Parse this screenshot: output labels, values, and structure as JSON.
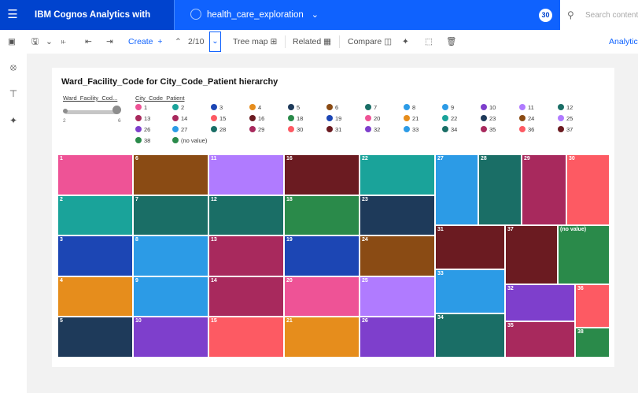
{
  "header": {
    "menu_icon": "hamburger-icon",
    "brand": "IBM Cognos Analytics with Watson",
    "report_name": "health_care_exploration",
    "avatar": "30",
    "search_placeholder": "Search content"
  },
  "toolbar": {
    "create_label": "Create",
    "page_indicator": "2/10",
    "treemap_label": "Tree map",
    "related_label": "Related",
    "compare_label": "Compare",
    "analytics_label": "Analytics"
  },
  "chart": {
    "title": "Ward_Facility_Code for City_Code_Patient hierarchy",
    "size_legend_label": "Ward_Facility_Cod...",
    "size_min": "2",
    "size_max": "6",
    "color_legend_label": "City_Code_Patient"
  },
  "colors": {
    "1": "#ee5396",
    "2": "#1aa39a",
    "3": "#1c46b4",
    "4": "#e68d1c",
    "5": "#1e3a5a",
    "6": "#8a4b14",
    "7": "#1a6e66",
    "8": "#2c9be6",
    "9": "#2c9be6",
    "10": "#7e3fcc",
    "11": "#b07bff",
    "12": "#1a6e66",
    "13": "#a8295d",
    "14": "#a8295d",
    "15": "#fd5a63",
    "16": "#6b1b21",
    "17": "#1a6e66",
    "18": "#2a8a4a",
    "19": "#1c46b4",
    "20": "#ee5396",
    "21": "#e68d1c",
    "22": "#1aa39a",
    "23": "#1e3a5a",
    "24": "#8a4b14",
    "25": "#b07bff",
    "26": "#7e3fcc",
    "27": "#2c9be6",
    "28": "#1a6e66",
    "29": "#a8295d",
    "30": "#fd5a63",
    "31": "#6b1b21",
    "32": "#7e3fcc",
    "33": "#2c9be6",
    "34": "#1a6e66",
    "35": "#a8295d",
    "36": "#fd5a63",
    "37": "#6b1b21",
    "38": "#2a8a4a",
    "nv": "#2a8a4a"
  },
  "legend": [
    {
      "key": "1",
      "label": "1"
    },
    {
      "key": "2",
      "label": "2"
    },
    {
      "key": "3",
      "label": "3"
    },
    {
      "key": "4",
      "label": "4"
    },
    {
      "key": "5",
      "label": "5"
    },
    {
      "key": "6",
      "label": "6"
    },
    {
      "key": "7",
      "label": "7"
    },
    {
      "key": "8",
      "label": "8"
    },
    {
      "key": "9",
      "label": "9"
    },
    {
      "key": "10",
      "label": "10"
    },
    {
      "key": "11",
      "label": "11"
    },
    {
      "key": "12",
      "label": "12"
    },
    {
      "key": "13",
      "label": "13"
    },
    {
      "key": "14",
      "label": "14"
    },
    {
      "key": "15",
      "label": "15"
    },
    {
      "key": "16",
      "label": "16"
    },
    {
      "key": "18",
      "label": "18"
    },
    {
      "key": "19",
      "label": "19"
    },
    {
      "key": "20",
      "label": "20"
    },
    {
      "key": "21",
      "label": "21"
    },
    {
      "key": "22",
      "label": "22"
    },
    {
      "key": "23",
      "label": "23"
    },
    {
      "key": "24",
      "label": "24"
    },
    {
      "key": "25",
      "label": "25"
    },
    {
      "key": "26",
      "label": "26"
    },
    {
      "key": "27",
      "label": "27"
    },
    {
      "key": "28",
      "label": "28"
    },
    {
      "key": "29",
      "label": "29"
    },
    {
      "key": "30",
      "label": "30"
    },
    {
      "key": "31",
      "label": "31"
    },
    {
      "key": "32",
      "label": "32"
    },
    {
      "key": "33",
      "label": "33"
    },
    {
      "key": "34",
      "label": "34"
    },
    {
      "key": "35",
      "label": "35"
    },
    {
      "key": "36",
      "label": "36"
    },
    {
      "key": "37",
      "label": "37"
    },
    {
      "key": "38",
      "label": "38"
    },
    {
      "key": "nv",
      "label": "(no value)"
    }
  ],
  "treemap_cells": [
    {
      "key": "1",
      "label": "1"
    },
    {
      "key": "2",
      "label": "2"
    },
    {
      "key": "3",
      "label": "3"
    },
    {
      "key": "4",
      "label": "4"
    },
    {
      "key": "5",
      "label": "5"
    },
    {
      "key": "6",
      "label": "6"
    },
    {
      "key": "7",
      "label": "7"
    },
    {
      "key": "8",
      "label": "8"
    },
    {
      "key": "9",
      "label": "9"
    },
    {
      "key": "10",
      "label": "10"
    },
    {
      "key": "11",
      "label": "11"
    },
    {
      "key": "12",
      "label": "12"
    },
    {
      "key": "13",
      "label": "13"
    },
    {
      "key": "14",
      "label": "14"
    },
    {
      "key": "15",
      "label": "15"
    },
    {
      "key": "16",
      "label": "16"
    },
    {
      "key": "18",
      "label": "18"
    },
    {
      "key": "19",
      "label": "19"
    },
    {
      "key": "20",
      "label": "20"
    },
    {
      "key": "21",
      "label": "21"
    },
    {
      "key": "22",
      "label": "22"
    },
    {
      "key": "23",
      "label": "23"
    },
    {
      "key": "24",
      "label": "24"
    },
    {
      "key": "25",
      "label": "25"
    },
    {
      "key": "26",
      "label": "26"
    },
    {
      "key": "27",
      "label": "27"
    },
    {
      "key": "28",
      "label": "28"
    },
    {
      "key": "29",
      "label": "29"
    },
    {
      "key": "30",
      "label": "30"
    },
    {
      "key": "31",
      "label": "31"
    },
    {
      "key": "37",
      "label": "37"
    },
    {
      "key": "nv",
      "label": "(no value)"
    },
    {
      "key": "33",
      "label": "33"
    },
    {
      "key": "32",
      "label": "32"
    },
    {
      "key": "36",
      "label": "36"
    },
    {
      "key": "34",
      "label": "34"
    },
    {
      "key": "35",
      "label": "35"
    },
    {
      "key": "38",
      "label": "38"
    }
  ]
}
